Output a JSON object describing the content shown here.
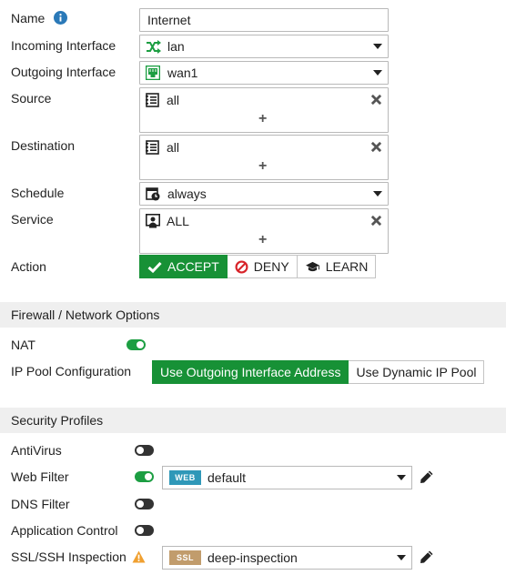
{
  "labels": {
    "name": "Name",
    "incoming": "Incoming Interface",
    "outgoing": "Outgoing Interface",
    "source": "Source",
    "destination": "Destination",
    "schedule": "Schedule",
    "service": "Service",
    "action": "Action"
  },
  "fields": {
    "name_value": "Internet",
    "incoming_value": "lan",
    "outgoing_value": "wan1",
    "source_entry": "all",
    "destination_entry": "all",
    "schedule_value": "always",
    "service_entry": "ALL",
    "add_symbol": "+"
  },
  "action": {
    "accept": "ACCEPT",
    "deny": "DENY",
    "learn": "LEARN",
    "selected": "accept"
  },
  "firewall_section": {
    "title": "Firewall / Network Options",
    "nat_label": "NAT",
    "nat_enabled": true,
    "ippool_label": "IP Pool Configuration",
    "ippool_outgoing": "Use Outgoing Interface Address",
    "ippool_dynamic": "Use Dynamic IP Pool"
  },
  "security_section": {
    "title": "Security Profiles",
    "antivirus": {
      "label": "AntiVirus",
      "enabled": false
    },
    "web_filter": {
      "label": "Web Filter",
      "enabled": true,
      "badge": "WEB",
      "profile": "default"
    },
    "dns_filter": {
      "label": "DNS Filter",
      "enabled": false
    },
    "app_control": {
      "label": "Application Control",
      "enabled": false
    },
    "ssl_inspection": {
      "label": "SSL/SSH Inspection",
      "enabled": false,
      "badge": "SSL",
      "profile": "deep-inspection"
    }
  },
  "colors": {
    "accent_green": "#179136",
    "toggle_on": "#1c9e42",
    "info_blue": "#2a79b8",
    "warning_orange": "#f0a030",
    "web_badge": "#2f98b8",
    "ssl_badge": "#c19c6c"
  }
}
